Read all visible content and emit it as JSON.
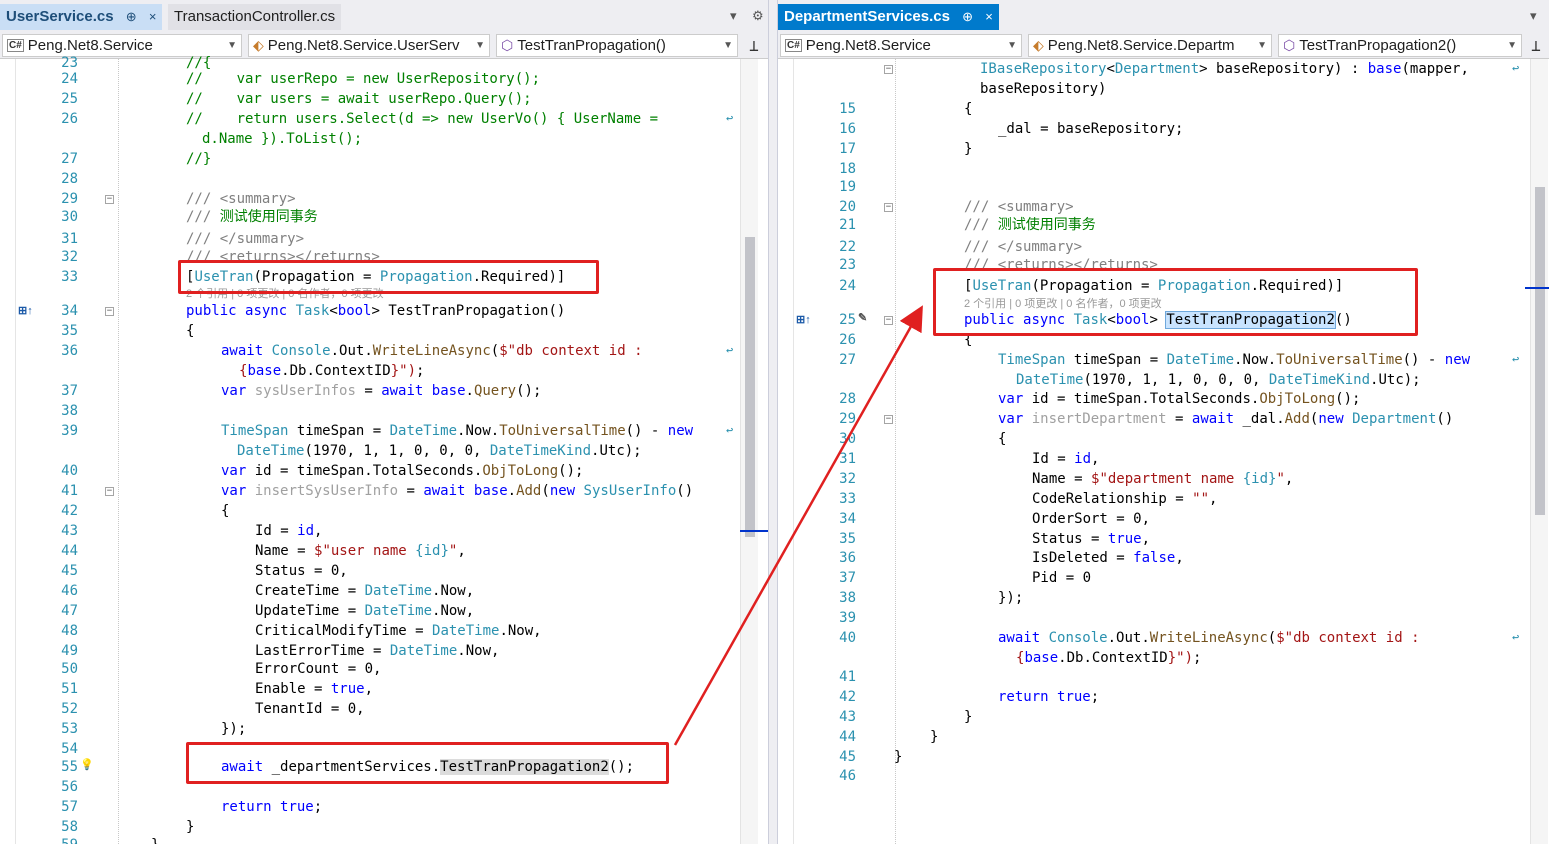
{
  "left": {
    "tabs": [
      {
        "label": "UserService.cs",
        "pin": "⊕",
        "close": "×"
      },
      {
        "label": "TransactionController.cs"
      }
    ],
    "nav": {
      "project": "Peng.Net8.Service",
      "type": "Peng.Net8.Service.UserServ",
      "member": "TestTranPropagation()"
    },
    "codelens": "2 个引用 | 0 项更改 | 0 名作者，0 项更改"
  },
  "right": {
    "tabs": [
      {
        "label": "DepartmentServices.cs",
        "pin": "⊕",
        "close": "×"
      }
    ],
    "nav": {
      "project": "Peng.Net8.Service",
      "type": "Peng.Net8.Service.Departm",
      "member": "TestTranPropagation2()"
    },
    "codelens": "2 个引用 | 0 项更改 | 0 名作者，0 项更改"
  },
  "colors": {
    "accent_tab": "#007acc",
    "annotation_red": "#e02020",
    "keyword": "#0000ff",
    "type": "#2b91af",
    "comment": "#008000",
    "string": "#a31515",
    "line_number": "#2b91af"
  },
  "icons": {
    "csharp_project": "csharp-project-icon",
    "class": "class-icon",
    "method": "method-icon",
    "split": "split-editor-icon",
    "lightbulb": "lightbulb-icon",
    "override_marker": "override-marker-icon"
  }
}
